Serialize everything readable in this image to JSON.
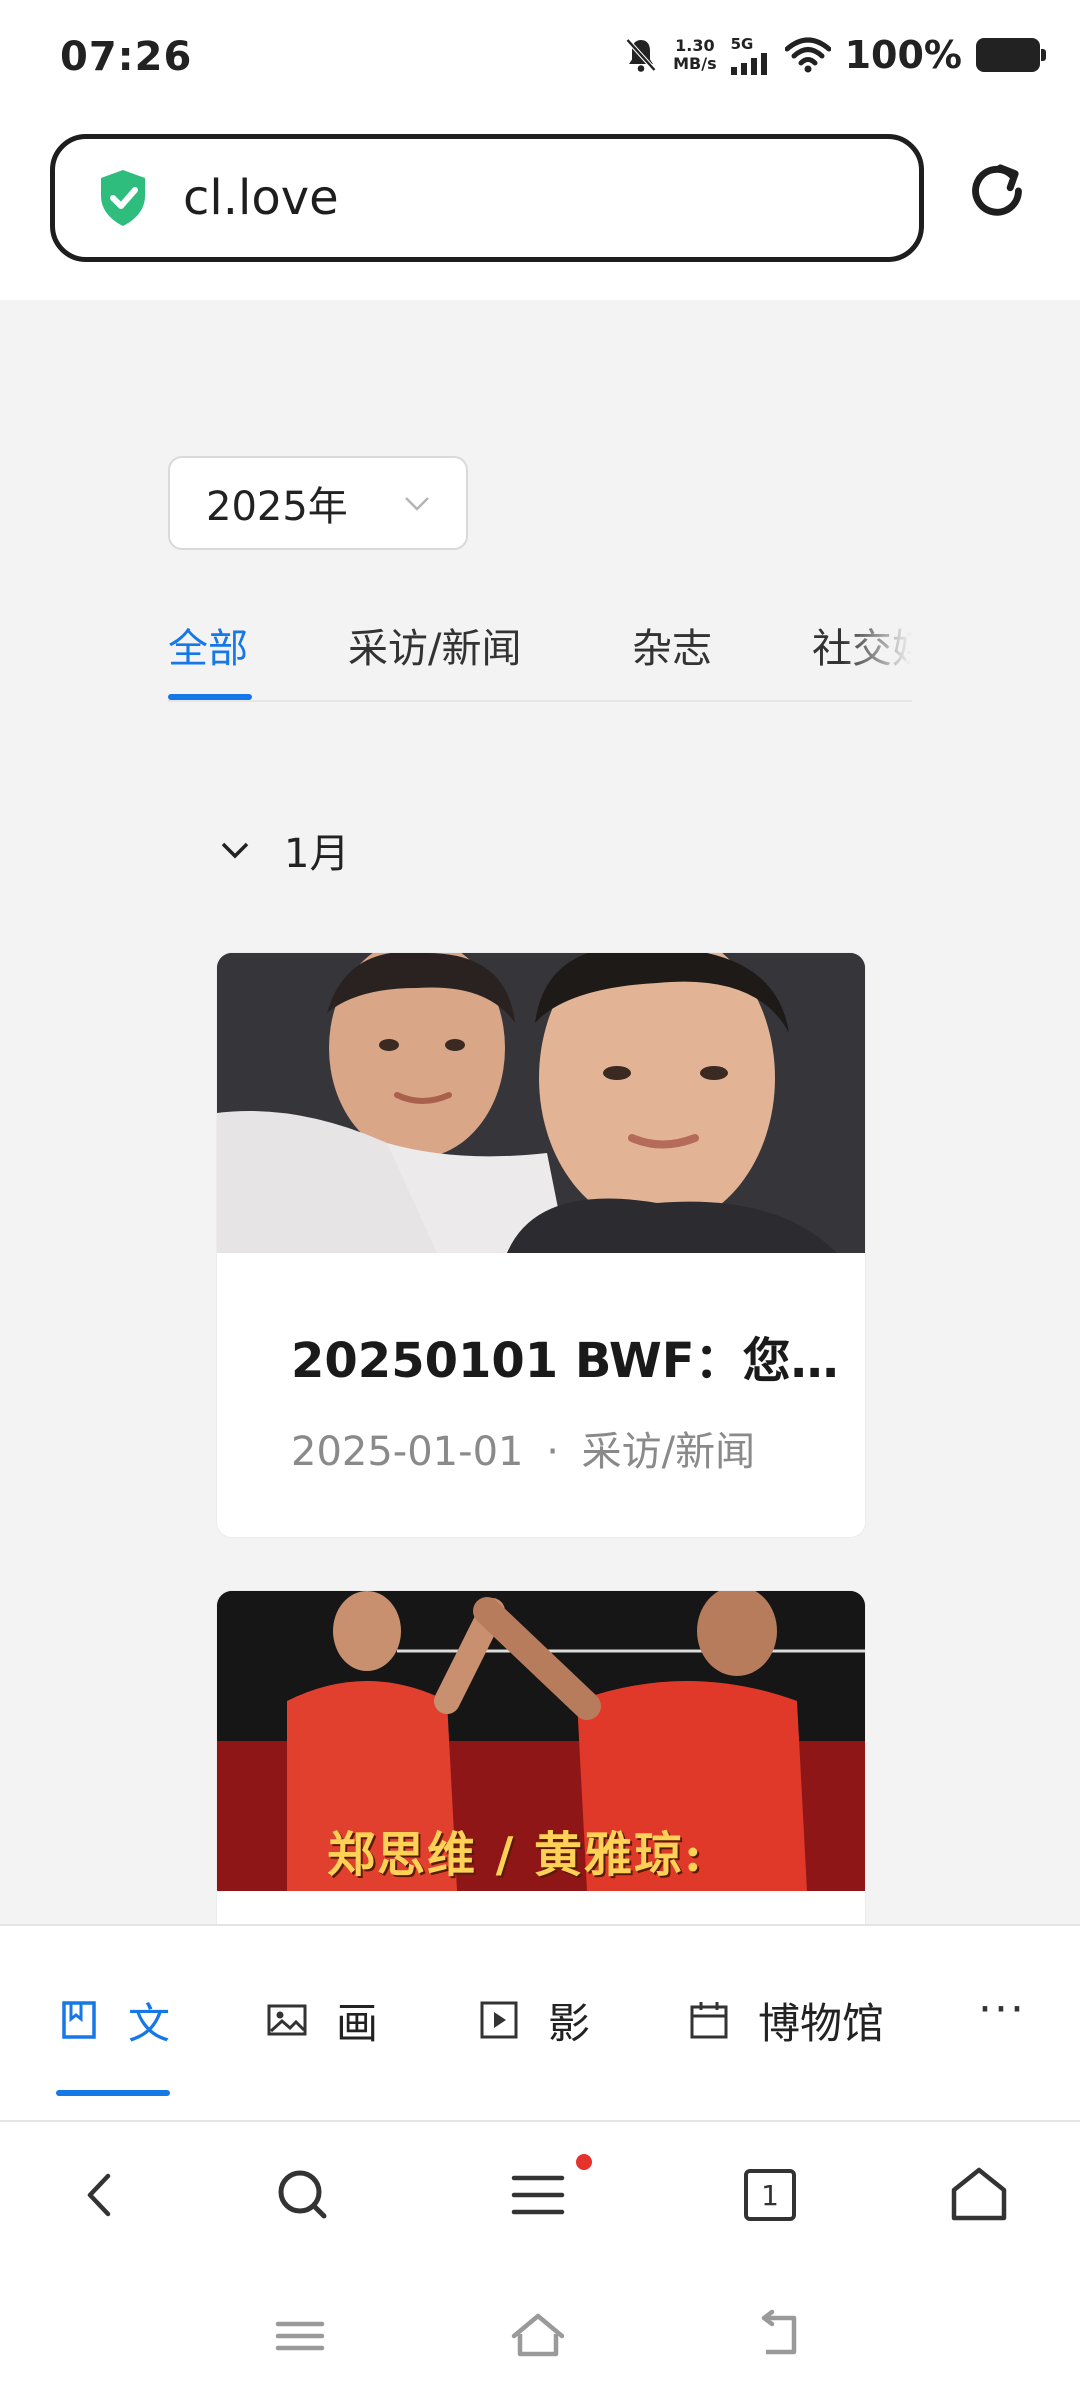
{
  "status_bar": {
    "time": "07:26",
    "speed_value": "1.30",
    "speed_unit": "MB/s",
    "network": "5G",
    "battery": "100%",
    "icons": [
      "bell-off-icon",
      "signal-icon",
      "wifi-icon",
      "battery-icon"
    ]
  },
  "address_bar": {
    "url": "cl.love",
    "security_icon": "shield-check-icon",
    "reload_icon": "reload-icon"
  },
  "page": {
    "year_select": {
      "value": "2025年"
    },
    "tabs": [
      {
        "label": "全部",
        "active": true
      },
      {
        "label": "采访/新闻",
        "active": false
      },
      {
        "label": "杂志",
        "active": false
      },
      {
        "label": "社交媒体",
        "active": false
      }
    ],
    "month": {
      "label": "1月",
      "expanded": true
    },
    "articles": [
      {
        "title": "20250101 BWF：您…",
        "date": "2025-01-01",
        "separator": "·",
        "category": "采访/新闻"
      },
      {
        "overlay_text": "郑思维 / 黄雅琼:"
      }
    ]
  },
  "section_nav": {
    "items": [
      {
        "label": "文",
        "icon": "book-icon",
        "active": true
      },
      {
        "label": "画",
        "icon": "image-icon",
        "active": false
      },
      {
        "label": "影",
        "icon": "play-icon",
        "active": false
      },
      {
        "label": "博物馆",
        "icon": "calendar-icon",
        "active": false
      }
    ],
    "more": "···"
  },
  "toolbar": {
    "tab_count": "1",
    "accent": "#1677e6",
    "badge_color": "#e5322d"
  }
}
